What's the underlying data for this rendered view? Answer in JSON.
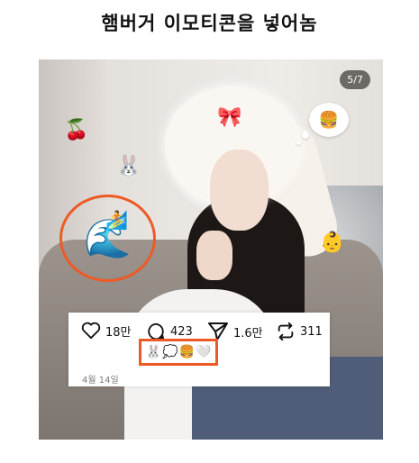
{
  "caption": "햄버거 이모티콘을 넣어놈",
  "photo": {
    "page_counter": "5/7",
    "stickers": {
      "cherries": "🍒",
      "rabbit": "🐰",
      "wave": "🌊",
      "surfer": "🏄",
      "baby": "👶",
      "hamburger_bubble": "🍔",
      "bow": "🎀"
    }
  },
  "post": {
    "likes": "18만",
    "comments": "423",
    "shares": "1.6만",
    "reposts": "311",
    "emoji_row": [
      "🐰",
      "💭",
      "🍔",
      "🤍"
    ],
    "date": "4월 14일"
  },
  "colors": {
    "highlight": "#ee5a26"
  }
}
